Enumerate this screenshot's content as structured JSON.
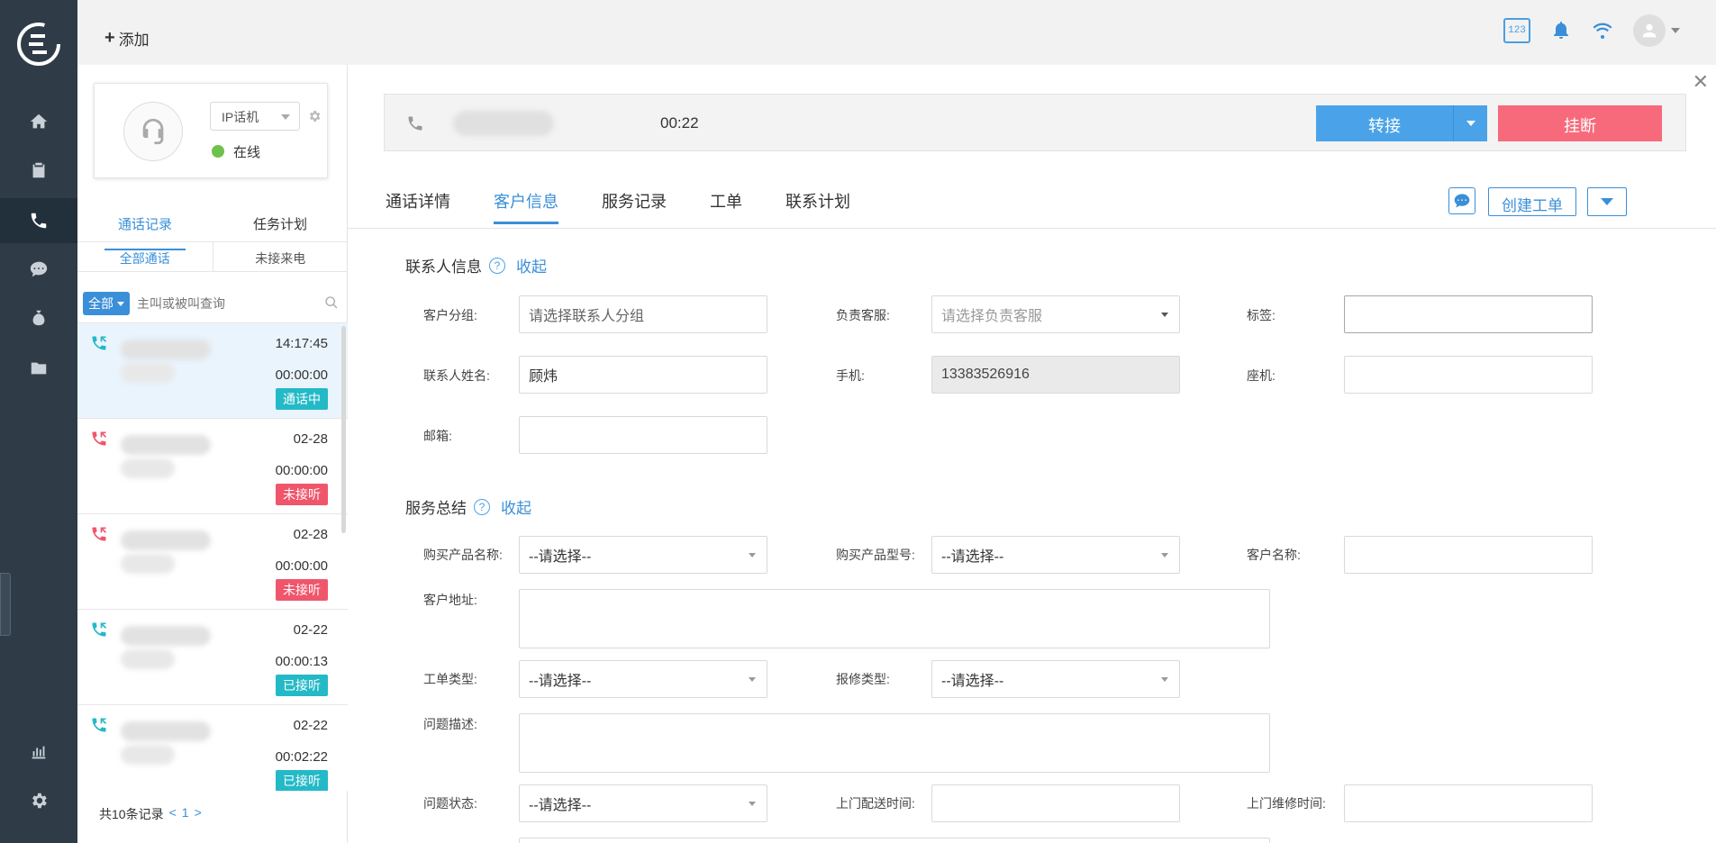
{
  "topbar": {
    "add_label": "添加",
    "keyboard_label": "123"
  },
  "agent": {
    "phone_type": "IP话机",
    "status": "在线"
  },
  "mid_tabs": [
    "通话记录",
    "任务计划"
  ],
  "sub_tabs": [
    "全部通话",
    "未接来电"
  ],
  "search": {
    "scope": "全部",
    "placeholder": "主叫或被叫查询"
  },
  "calls": [
    {
      "time": "14:17:45",
      "duration": "00:00:00",
      "status": "通话中",
      "status_color": "#24b9c7",
      "icon_color": "#24b9c7"
    },
    {
      "time": "02-28",
      "duration": "00:00:00",
      "status": "未接听",
      "status_color": "#f0566b",
      "icon_color": "#f0566b"
    },
    {
      "time": "02-28",
      "duration": "00:00:00",
      "status": "未接听",
      "status_color": "#f0566b",
      "icon_color": "#f0566b"
    },
    {
      "time": "02-22",
      "duration": "00:00:13",
      "status": "已接听",
      "status_color": "#24b9c7",
      "icon_color": "#24b9c7"
    },
    {
      "time": "02-22",
      "duration": "00:02:22",
      "status": "已接听",
      "status_color": "#24b9c7",
      "icon_color": "#24b9c7"
    }
  ],
  "pager": {
    "total": "共10条记录",
    "prev": "<",
    "page": "1",
    "next": ">"
  },
  "callbar": {
    "timer": "00:22",
    "transfer": "转接",
    "hangup": "挂断"
  },
  "main_tabs": [
    "通话详情",
    "客户信息",
    "服务记录",
    "工单",
    "联系计划"
  ],
  "actions": {
    "create_ticket": "创建工单"
  },
  "contact": {
    "title": "联系人信息",
    "collapse": "收起",
    "group_label": "客户分组:",
    "group_placeholder": "请选择联系人分组",
    "agent_label": "负责客服:",
    "agent_placeholder": "请选择负责客服",
    "tag_label": "标签:",
    "name_label": "联系人姓名:",
    "name_value": "顾炜",
    "mobile_label": "手机:",
    "mobile_value": "13383526916",
    "landline_label": "座机:",
    "email_label": "邮箱:"
  },
  "service": {
    "title": "服务总结",
    "collapse": "收起",
    "product_name_label": "购买产品名称:",
    "product_model_label": "购买产品型号:",
    "customer_name_label": "客户名称:",
    "address_label": "客户地址:",
    "ticket_type_label": "工单类型:",
    "repair_type_label": "报修类型:",
    "problem_desc_label": "问题描述:",
    "problem_status_label": "问题状态:",
    "delivery_time_label": "上门配送时间:",
    "repair_time_label": "上门维修时间:",
    "select_placeholder": "--请选择--"
  },
  "colors": {
    "accent": "#3a8fd8",
    "nav_bg": "#2f3c48",
    "hangup": "#f66a7b",
    "transfer": "#4aa3e8"
  }
}
